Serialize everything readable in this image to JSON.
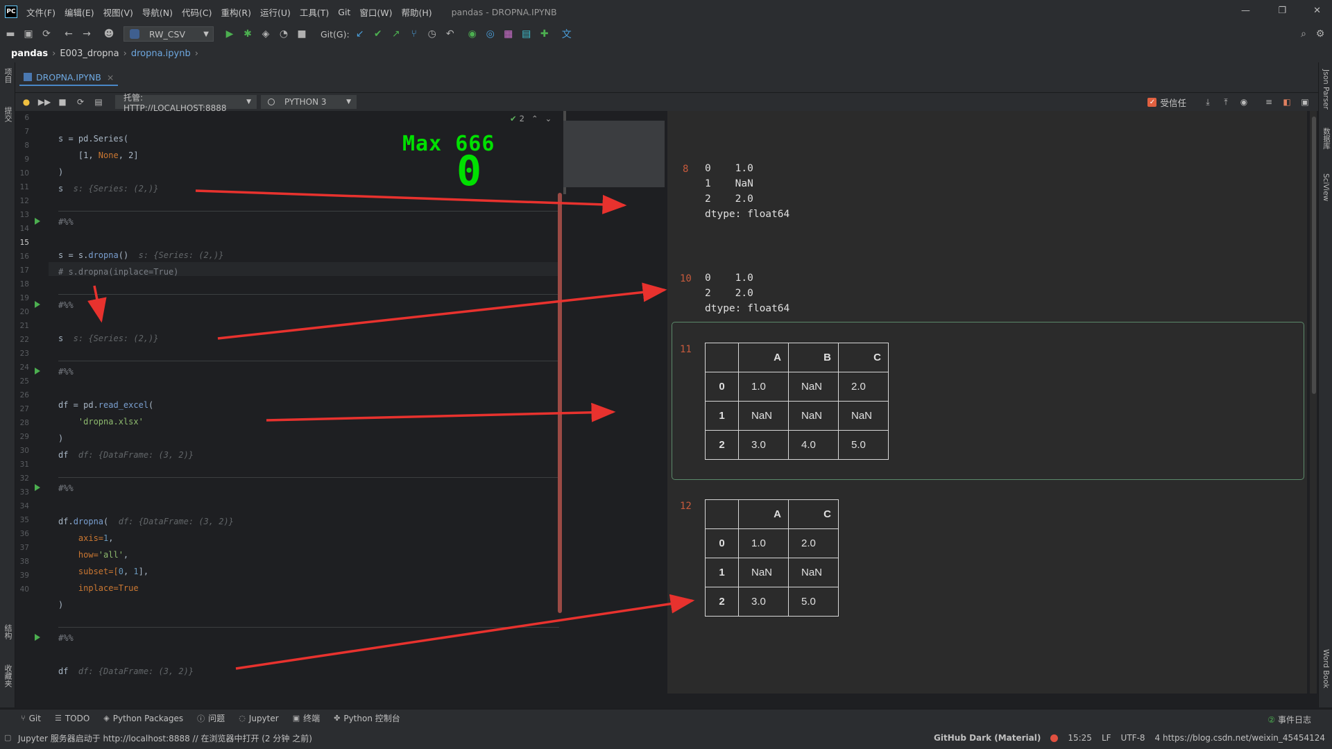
{
  "menubar": {
    "logo": "PC",
    "items": [
      "文件(F)",
      "编辑(E)",
      "视图(V)",
      "导航(N)",
      "代码(C)",
      "重构(R)",
      "运行(U)",
      "工具(T)",
      "Git",
      "窗口(W)",
      "帮助(H)"
    ],
    "title": "pandas - DROPNA.IPYNB"
  },
  "toolbar": {
    "run_config": "RW_CSV",
    "git_label": "Git(G):"
  },
  "breadcrumb": {
    "project": "pandas",
    "folder": "E003_dropna",
    "file": "dropna.ipynb"
  },
  "left_strip": {
    "top": "项目",
    "commit": "提交",
    "structure": "结构",
    "favorites": "收藏夹"
  },
  "right_strip": {
    "json": "Json Parser",
    "db": "数据库",
    "sciview": "SciView",
    "wordbook": "Word Book"
  },
  "tab": {
    "label": "DROPNA.IPYNB",
    "close": "×"
  },
  "nb_toolbar": {
    "server": "托管: HTTP://LOCALHOST:8888",
    "kernel": "PYTHON 3",
    "trusted": "受信任"
  },
  "inspect": {
    "count": "2"
  },
  "overlay": {
    "max_label": "Max 666",
    "counter": "0"
  },
  "code": {
    "line_numbers": [
      "6",
      "7",
      "8",
      "9",
      "10",
      "11",
      "12",
      "13",
      "14",
      "15",
      "16",
      "17",
      "18",
      "19",
      "20",
      "21",
      "22",
      "23",
      "24",
      "25",
      "26",
      "27",
      "28",
      "29",
      "30",
      "31",
      "32",
      "33",
      "34",
      "35",
      "36",
      "37",
      "38",
      "39",
      "40"
    ],
    "current_line": "15",
    "l7": "s = pd.Series(",
    "l8a": "    [1, ",
    "l8b": "None",
    "l8c": ", 2]",
    "l9": ")",
    "l10a": "s",
    "l10h": "  s: {Series: (2,)}",
    "l12": "#%%",
    "l14a": "s = s.",
    "l14b": "dropna",
    "l14c": "()",
    "l14h": "  s: {Series: (2,)}",
    "l15": "# s.dropna(inplace=True)",
    "l17": "#%%",
    "l19a": "s",
    "l19h": "  s: {Series: (2,)}",
    "l21": "#%%",
    "l23a": "df = pd.",
    "l23b": "read_excel",
    "l23c": "(",
    "l24": "    'dropna.xlsx'",
    "l25": ")",
    "l26a": "df",
    "l26h": "  df: {DataFrame: (3, 2)}",
    "l28": "#%%",
    "l30a": "df.",
    "l30b": "dropna",
    "l30c": "(",
    "l30h": "  df: {DataFrame: (3, 2)}",
    "l31a": "    axis=",
    "l31b": "1",
    "l31c": ",",
    "l32a": "    how=",
    "l32b": "'all'",
    "l32c": ",",
    "l33a": "    subset=[",
    "l33b": "0",
    "l33c": ", ",
    "l33d": "1",
    "l33e": "],",
    "l34a": "    inplace=",
    "l34b": "True",
    "l35": ")",
    "l37": "#%%",
    "l39a": "df",
    "l39h": "  df: {DataFrame: (3, 2)}"
  },
  "outputs": {
    "o8": {
      "no": "8",
      "text": "0    1.0\n1    NaN\n2    2.0\ndtype: float64"
    },
    "o10": {
      "no": "10",
      "text": "0    1.0\n2    2.0\ndtype: float64"
    },
    "o11": {
      "no": "11",
      "columns": [
        "",
        "A",
        "B",
        "C"
      ],
      "rows": [
        [
          "0",
          "1.0",
          "NaN",
          "2.0"
        ],
        [
          "1",
          "NaN",
          "NaN",
          "NaN"
        ],
        [
          "2",
          "3.0",
          "4.0",
          "5.0"
        ]
      ]
    },
    "o12": {
      "no": "12",
      "columns": [
        "",
        "A",
        "C"
      ],
      "rows": [
        [
          "0",
          "1.0",
          "2.0"
        ],
        [
          "1",
          "NaN",
          "NaN"
        ],
        [
          "2",
          "3.0",
          "5.0"
        ]
      ]
    }
  },
  "bottom_tabs": [
    "Git",
    "TODO",
    "Python Packages",
    "问题",
    "Jupyter",
    "终端",
    "Python 控制台"
  ],
  "event_log": "事件日志",
  "status": {
    "message": "Jupyter 服务器启动于 http://localhost:8888 // 在浏览器中打开 (2 分钟 之前)",
    "theme": "GitHub Dark (Material)",
    "position": "15:25",
    "line_sep": "LF",
    "encoding": "UTF-8",
    "watermark": "4 https://blog.csdn.net/weixin_45454124"
  },
  "colors": {
    "arrow": "#e8322e",
    "overlay_green": "#00e000",
    "output_number": "#c75a3c"
  }
}
